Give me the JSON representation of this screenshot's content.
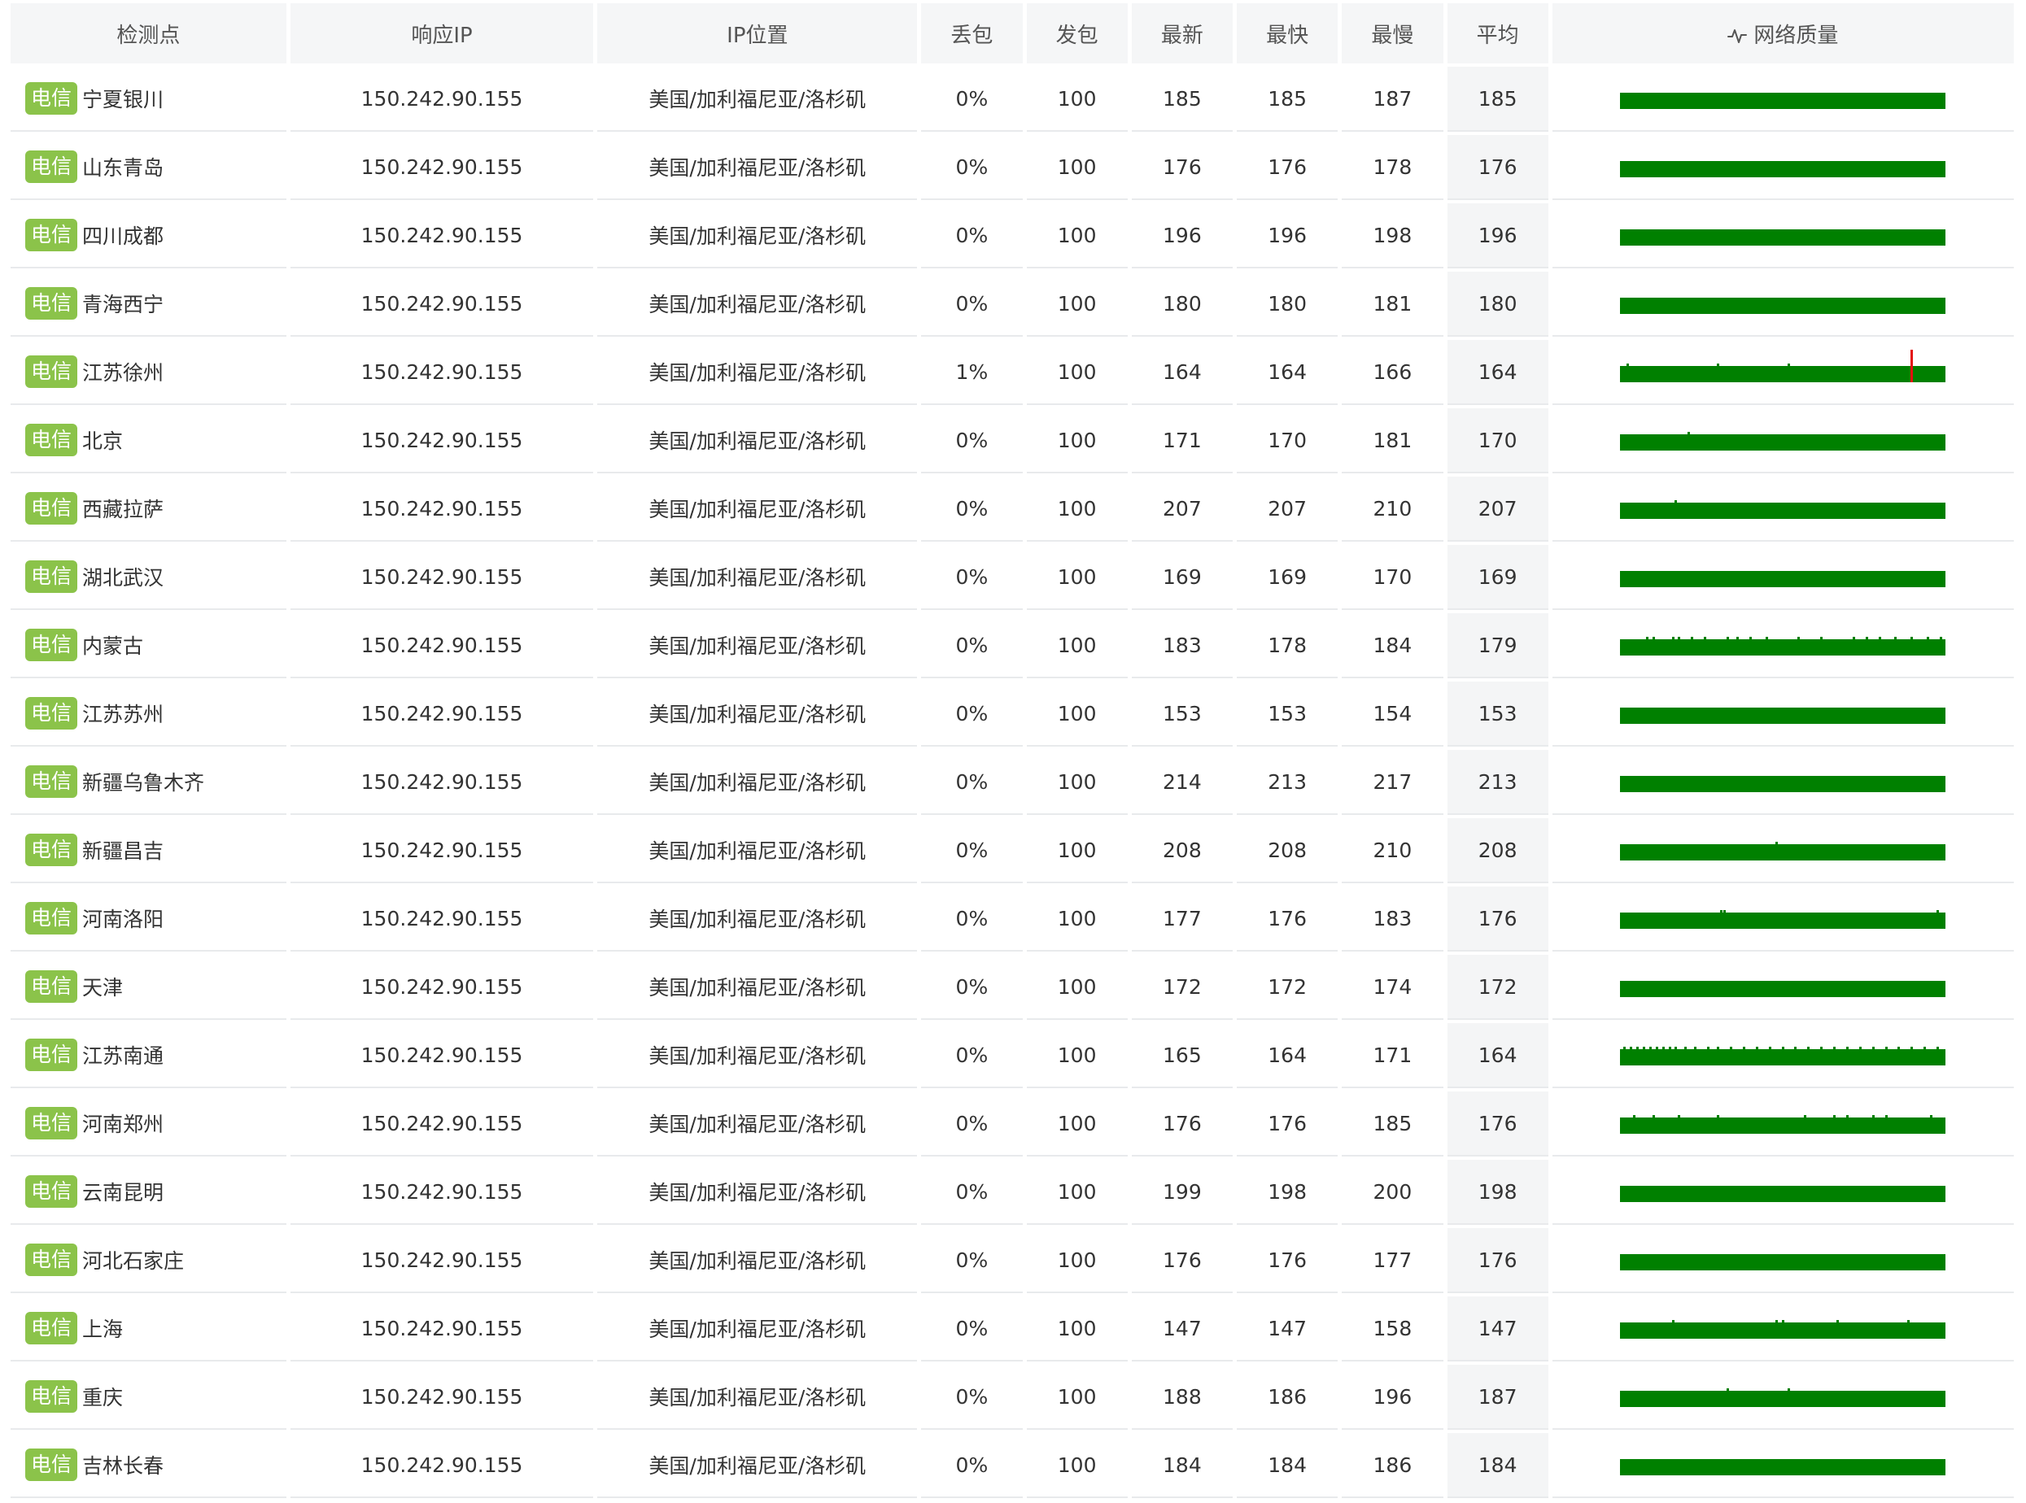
{
  "columns": {
    "site": "检测点",
    "ip": "响应IP",
    "location": "IP位置",
    "loss": "丢包",
    "sent": "发包",
    "latest": "最新",
    "fastest": "最快",
    "slowest": "最慢",
    "average": "平均",
    "quality": "网络质量",
    "quality_icon": "pulse-icon"
  },
  "colors": {
    "badge": "#8bc34a",
    "bar": "#008000",
    "loss_mark": "#e3100f",
    "header_bg": "#f5f6f7"
  },
  "rows": [
    {
      "isp": "电信",
      "site": "宁夏银川",
      "ip": "150.242.90.155",
      "location": "美国/加利福尼亚/洛杉矶",
      "loss": "0%",
      "sent": "100",
      "latest": "185",
      "fastest": "185",
      "slowest": "187",
      "average": "185",
      "quality": {
        "loss_at": [],
        "jitter_at": []
      }
    },
    {
      "isp": "电信",
      "site": "山东青岛",
      "ip": "150.242.90.155",
      "location": "美国/加利福尼亚/洛杉矶",
      "loss": "0%",
      "sent": "100",
      "latest": "176",
      "fastest": "176",
      "slowest": "178",
      "average": "176",
      "quality": {
        "loss_at": [],
        "jitter_at": []
      }
    },
    {
      "isp": "电信",
      "site": "四川成都",
      "ip": "150.242.90.155",
      "location": "美国/加利福尼亚/洛杉矶",
      "loss": "0%",
      "sent": "100",
      "latest": "196",
      "fastest": "196",
      "slowest": "198",
      "average": "196",
      "quality": {
        "loss_at": [],
        "jitter_at": []
      }
    },
    {
      "isp": "电信",
      "site": "青海西宁",
      "ip": "150.242.90.155",
      "location": "美国/加利福尼亚/洛杉矶",
      "loss": "0%",
      "sent": "100",
      "latest": "180",
      "fastest": "180",
      "slowest": "181",
      "average": "180",
      "quality": {
        "loss_at": [],
        "jitter_at": []
      }
    },
    {
      "isp": "电信",
      "site": "江苏徐州",
      "ip": "150.242.90.155",
      "location": "美国/加利福尼亚/洛杉矶",
      "loss": "1%",
      "sent": "100",
      "latest": "164",
      "fastest": "164",
      "slowest": "166",
      "average": "164",
      "quality": {
        "loss_at": [
          90
        ],
        "jitter_at": [
          2,
          30,
          52
        ]
      }
    },
    {
      "isp": "电信",
      "site": "北京",
      "ip": "150.242.90.155",
      "location": "美国/加利福尼亚/洛杉矶",
      "loss": "0%",
      "sent": "100",
      "latest": "171",
      "fastest": "170",
      "slowest": "181",
      "average": "170",
      "quality": {
        "loss_at": [],
        "jitter_at": [
          21
        ]
      }
    },
    {
      "isp": "电信",
      "site": "西藏拉萨",
      "ip": "150.242.90.155",
      "location": "美国/加利福尼亚/洛杉矶",
      "loss": "0%",
      "sent": "100",
      "latest": "207",
      "fastest": "207",
      "slowest": "210",
      "average": "207",
      "quality": {
        "loss_at": [],
        "jitter_at": [
          17
        ]
      }
    },
    {
      "isp": "电信",
      "site": "湖北武汉",
      "ip": "150.242.90.155",
      "location": "美国/加利福尼亚/洛杉矶",
      "loss": "0%",
      "sent": "100",
      "latest": "169",
      "fastest": "169",
      "slowest": "170",
      "average": "169",
      "quality": {
        "loss_at": [],
        "jitter_at": []
      }
    },
    {
      "isp": "电信",
      "site": "内蒙古",
      "ip": "150.242.90.155",
      "location": "美国/加利福尼亚/洛杉矶",
      "loss": "0%",
      "sent": "100",
      "latest": "183",
      "fastest": "178",
      "slowest": "184",
      "average": "179",
      "quality": {
        "loss_at": [],
        "jitter_at": [
          8,
          10,
          16,
          18,
          22,
          26,
          33,
          36,
          40,
          45,
          55,
          62,
          72,
          76,
          80,
          85,
          90,
          95,
          99
        ]
      }
    },
    {
      "isp": "电信",
      "site": "江苏苏州",
      "ip": "150.242.90.155",
      "location": "美国/加利福尼亚/洛杉矶",
      "loss": "0%",
      "sent": "100",
      "latest": "153",
      "fastest": "153",
      "slowest": "154",
      "average": "153",
      "quality": {
        "loss_at": [],
        "jitter_at": []
      }
    },
    {
      "isp": "电信",
      "site": "新疆乌鲁木齐",
      "ip": "150.242.90.155",
      "location": "美国/加利福尼亚/洛杉矶",
      "loss": "0%",
      "sent": "100",
      "latest": "214",
      "fastest": "213",
      "slowest": "217",
      "average": "213",
      "quality": {
        "loss_at": [],
        "jitter_at": []
      }
    },
    {
      "isp": "电信",
      "site": "新疆昌吉",
      "ip": "150.242.90.155",
      "location": "美国/加利福尼亚/洛杉矶",
      "loss": "0%",
      "sent": "100",
      "latest": "208",
      "fastest": "208",
      "slowest": "210",
      "average": "208",
      "quality": {
        "loss_at": [],
        "jitter_at": [
          48
        ]
      }
    },
    {
      "isp": "电信",
      "site": "河南洛阳",
      "ip": "150.242.90.155",
      "location": "美国/加利福尼亚/洛杉矶",
      "loss": "0%",
      "sent": "100",
      "latest": "177",
      "fastest": "176",
      "slowest": "183",
      "average": "176",
      "quality": {
        "loss_at": [],
        "jitter_at": [
          31,
          32,
          98
        ]
      }
    },
    {
      "isp": "电信",
      "site": "天津",
      "ip": "150.242.90.155",
      "location": "美国/加利福尼亚/洛杉矶",
      "loss": "0%",
      "sent": "100",
      "latest": "172",
      "fastest": "172",
      "slowest": "174",
      "average": "172",
      "quality": {
        "loss_at": [],
        "jitter_at": []
      }
    },
    {
      "isp": "电信",
      "site": "江苏南通",
      "ip": "150.242.90.155",
      "location": "美国/加利福尼亚/洛杉矶",
      "loss": "0%",
      "sent": "100",
      "latest": "165",
      "fastest": "164",
      "slowest": "171",
      "average": "164",
      "quality": {
        "loss_at": [],
        "jitter_at": [
          1,
          3,
          5,
          7,
          9,
          11,
          13,
          15,
          17,
          20,
          23,
          27,
          30,
          34,
          38,
          42,
          46,
          50,
          54,
          58,
          62,
          66,
          70,
          74,
          78,
          82,
          86,
          90,
          94,
          98
        ]
      }
    },
    {
      "isp": "电信",
      "site": "河南郑州",
      "ip": "150.242.90.155",
      "location": "美国/加利福尼亚/洛杉矶",
      "loss": "0%",
      "sent": "100",
      "latest": "176",
      "fastest": "176",
      "slowest": "185",
      "average": "176",
      "quality": {
        "loss_at": [],
        "jitter_at": [
          4,
          10,
          18,
          30,
          57,
          66,
          70,
          78,
          82,
          96
        ]
      }
    },
    {
      "isp": "电信",
      "site": "云南昆明",
      "ip": "150.242.90.155",
      "location": "美国/加利福尼亚/洛杉矶",
      "loss": "0%",
      "sent": "100",
      "latest": "199",
      "fastest": "198",
      "slowest": "200",
      "average": "198",
      "quality": {
        "loss_at": [],
        "jitter_at": []
      }
    },
    {
      "isp": "电信",
      "site": "河北石家庄",
      "ip": "150.242.90.155",
      "location": "美国/加利福尼亚/洛杉矶",
      "loss": "0%",
      "sent": "100",
      "latest": "176",
      "fastest": "176",
      "slowest": "177",
      "average": "176",
      "quality": {
        "loss_at": [],
        "jitter_at": []
      }
    },
    {
      "isp": "电信",
      "site": "上海",
      "ip": "150.242.90.155",
      "location": "美国/加利福尼亚/洛杉矶",
      "loss": "0%",
      "sent": "100",
      "latest": "147",
      "fastest": "147",
      "slowest": "158",
      "average": "147",
      "quality": {
        "loss_at": [],
        "jitter_at": [
          16,
          48,
          50,
          67,
          89
        ]
      }
    },
    {
      "isp": "电信",
      "site": "重庆",
      "ip": "150.242.90.155",
      "location": "美国/加利福尼亚/洛杉矶",
      "loss": "0%",
      "sent": "100",
      "latest": "188",
      "fastest": "186",
      "slowest": "196",
      "average": "187",
      "quality": {
        "loss_at": [],
        "jitter_at": [
          33,
          52
        ]
      }
    },
    {
      "isp": "电信",
      "site": "吉林长春",
      "ip": "150.242.90.155",
      "location": "美国/加利福尼亚/洛杉矶",
      "loss": "0%",
      "sent": "100",
      "latest": "184",
      "fastest": "184",
      "slowest": "186",
      "average": "184",
      "quality": {
        "loss_at": [],
        "jitter_at": []
      }
    }
  ]
}
